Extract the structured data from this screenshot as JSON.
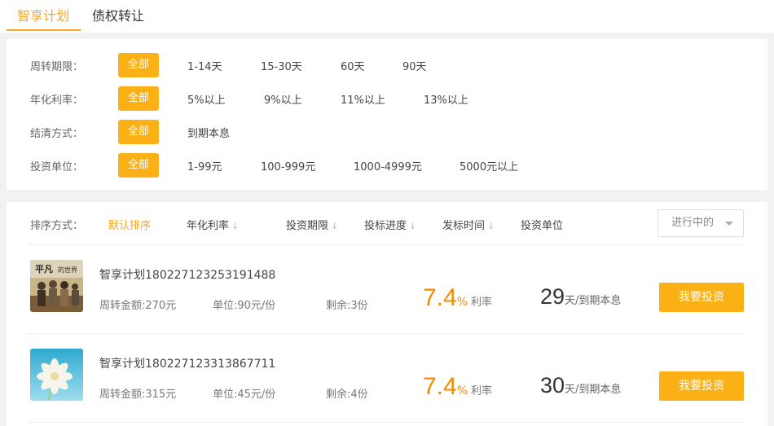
{
  "tabs": [
    {
      "label": "智享计划",
      "active": true
    },
    {
      "label": "债权转让",
      "active": false
    }
  ],
  "filters": [
    {
      "label": "周转期限：",
      "all": "全部",
      "options": [
        "1-14天",
        "15-30天",
        "60天",
        "90天"
      ]
    },
    {
      "label": "年化利率：",
      "all": "全部",
      "options": [
        "5%以上",
        "9%以上",
        "11%以上",
        "13%以上"
      ]
    },
    {
      "label": "结清方式：",
      "all": "全部",
      "options": [
        "到期本息"
      ]
    },
    {
      "label": "投资单位：",
      "all": "全部",
      "options": [
        "1-99元",
        "100-999元",
        "1000-4999元",
        "5000元以上"
      ]
    }
  ],
  "sort": {
    "label": "排序方式：",
    "options": [
      "默认排序",
      "年化利率",
      "投资期限",
      "投标进度",
      "发标时间",
      "投资单位"
    ],
    "status": "进行中的"
  },
  "items": [
    {
      "title": "智享计划180227123253191488",
      "amount": "周转金额:270元",
      "unit": "单位:90元/份",
      "remaining": "剩余:3份",
      "rate": "7.4",
      "rate_pct": "%",
      "rate_label": "利率",
      "days": "29",
      "days_unit": "天/到期本息",
      "button": "我要投资",
      "thumb_icon": "movie-poster-image"
    },
    {
      "title": "智享计划180227123313867711",
      "amount": "周转金额:315元",
      "unit": "单位:45元/份",
      "remaining": "剩余:4份",
      "rate": "7.4",
      "rate_pct": "%",
      "rate_label": "利率",
      "days": "30",
      "days_unit": "天/到期本息",
      "button": "我要投资",
      "thumb_icon": "flower-image"
    }
  ],
  "colors": {
    "accent": "#fbb016",
    "tab_active": "#f5a623",
    "rate": "#f38a00"
  }
}
